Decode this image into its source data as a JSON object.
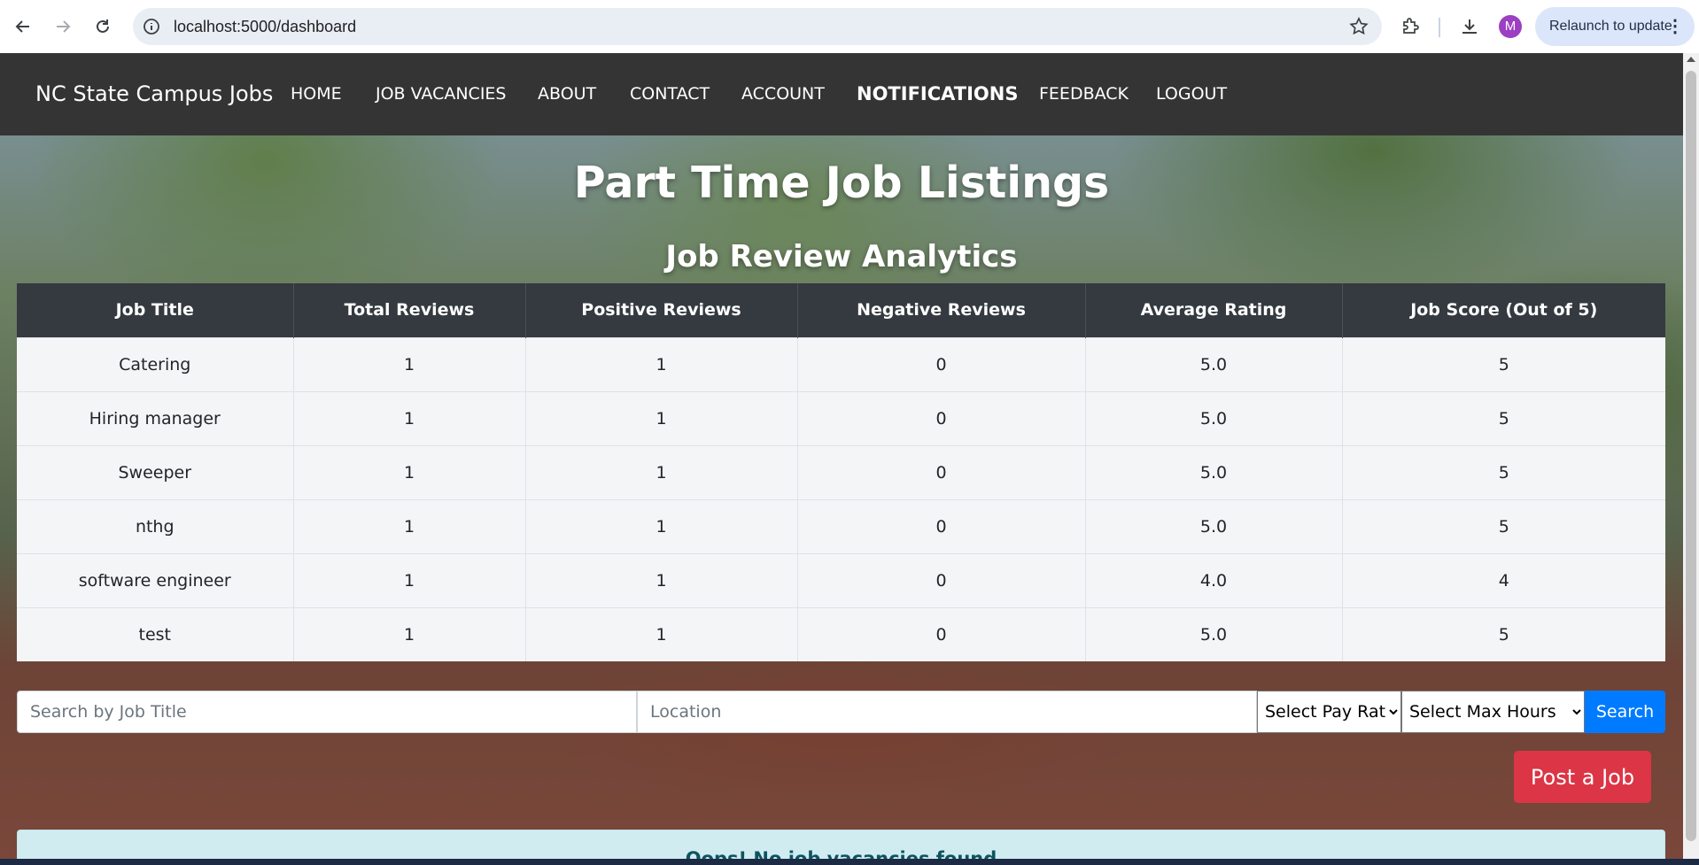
{
  "browser": {
    "url": "localhost:5000/dashboard",
    "relaunch_label": "Relaunch to update",
    "profile_initial": "M"
  },
  "navbar": {
    "brand": "NC State Campus Jobs",
    "links": [
      "HOME",
      "JOB VACANCIES",
      "ABOUT",
      "CONTACT",
      "ACCOUNT",
      "NOTIFICATIONS",
      "FEEDBACK",
      "LOGOUT"
    ],
    "active": "NOTIFICATIONS"
  },
  "page": {
    "title": "Part Time Job Listings",
    "subtitle": "Job Review Analytics"
  },
  "analytics": {
    "headers": [
      "Job Title",
      "Total Reviews",
      "Positive Reviews",
      "Negative Reviews",
      "Average Rating",
      "Job Score (Out of 5)"
    ],
    "rows": [
      [
        "Catering",
        "1",
        "1",
        "0",
        "5.0",
        "5"
      ],
      [
        "Hiring manager",
        "1",
        "1",
        "0",
        "5.0",
        "5"
      ],
      [
        "Sweeper",
        "1",
        "1",
        "0",
        "5.0",
        "5"
      ],
      [
        "nthg",
        "1",
        "1",
        "0",
        "5.0",
        "5"
      ],
      [
        "software engineer",
        "1",
        "1",
        "0",
        "4.0",
        "4"
      ],
      [
        "test",
        "1",
        "1",
        "0",
        "5.0",
        "5"
      ]
    ]
  },
  "search": {
    "title_placeholder": "Search by Job Title",
    "location_placeholder": "Location",
    "pay_rate_selected": "Select Pay Rate",
    "max_hours_selected": "Select Max Hours",
    "button_label": "Search"
  },
  "post_job_label": "Post a Job",
  "alert_text": "Oops! No job vacancies found",
  "colors": {
    "navbar": "#343434",
    "table_header": "#343a40",
    "primary": "#007bff",
    "danger": "#dc3545",
    "alert_bg": "#d1ecf1",
    "alert_text": "#0c5460"
  }
}
